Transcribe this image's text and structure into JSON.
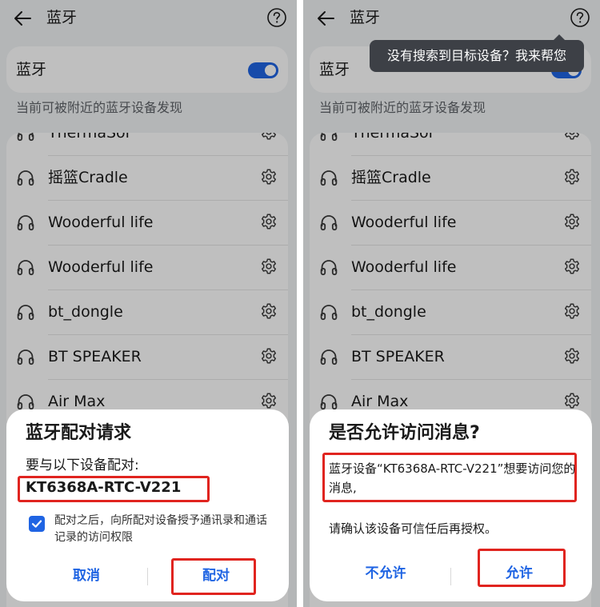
{
  "colors": {
    "accent": "#1f64e3",
    "highlight_box": "#e0241f",
    "tooltip_bg": "#3d4046"
  },
  "left": {
    "header": {
      "title": "蓝牙",
      "back_icon": "arrow-left-icon",
      "help_icon": "question-circle-icon"
    },
    "bluetooth_toggle": {
      "label": "蓝牙",
      "state": "on"
    },
    "discoverable_hint": "当前可被附近的蓝牙设备发现",
    "devices": [
      {
        "name": "ThermaSol"
      },
      {
        "name": "摇篮Cradle"
      },
      {
        "name": "Wooderful life"
      },
      {
        "name": "Wooderful life"
      },
      {
        "name": "bt_dongle"
      },
      {
        "name": "BT SPEAKER"
      },
      {
        "name": "Air Max"
      }
    ],
    "dialog": {
      "title": "蓝牙配对请求",
      "subtitle": "要与以下设备配对:",
      "device_name": "KT6368A-RTC-V221",
      "checkbox_label": "配对之后，向所配对设备授予通讯录和通话记录的访问权限",
      "checkbox_checked": true,
      "cancel_label": "取消",
      "pair_label": "配对"
    }
  },
  "right": {
    "header": {
      "title": "蓝牙",
      "back_icon": "arrow-left-icon",
      "help_icon": "question-circle-icon"
    },
    "tooltip": "没有搜索到目标设备？我来帮您",
    "bluetooth_toggle": {
      "label": "蓝牙",
      "state": "on"
    },
    "discoverable_hint": "当前可被附近的蓝牙设备发现",
    "devices": [
      {
        "name": "ThermaSol"
      },
      {
        "name": "摇篮Cradle"
      },
      {
        "name": "Wooderful life"
      },
      {
        "name": "Wooderful life"
      },
      {
        "name": "bt_dongle"
      },
      {
        "name": "BT SPEAKER"
      },
      {
        "name": "Air Max"
      }
    ],
    "dialog": {
      "title": "是否允许访问消息?",
      "message": "蓝牙设备“KT6368A-RTC-V221”想要访问您的消息,",
      "confirm_text": "请确认该设备可信任后再授权。",
      "deny_label": "不允许",
      "allow_label": "允许"
    }
  }
}
